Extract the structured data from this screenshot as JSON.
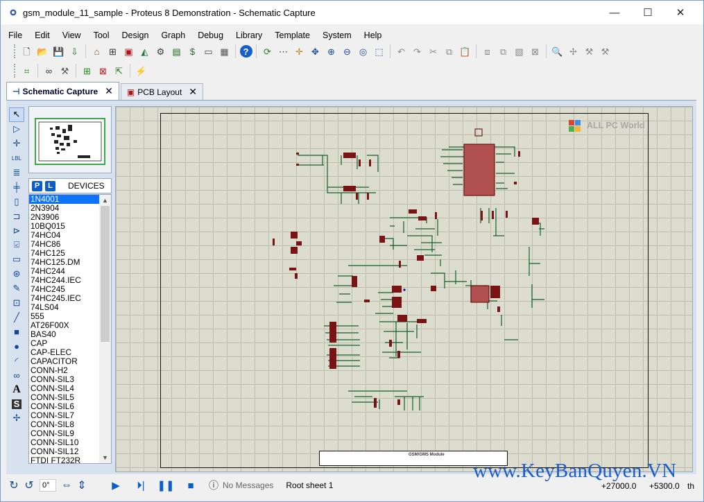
{
  "window": {
    "title": "gsm_module_11_sample - Proteus 8 Demonstration - Schematic Capture",
    "minimize": "—",
    "maximize": "☐",
    "close": "✕"
  },
  "menu": [
    "File",
    "Edit",
    "View",
    "Tool",
    "Design",
    "Graph",
    "Debug",
    "Library",
    "Template",
    "System",
    "Help"
  ],
  "toolbar1": {
    "file_group": [
      {
        "icon": "new-file-icon",
        "glyph": "🗋",
        "color": "#444"
      },
      {
        "icon": "open-folder-icon",
        "glyph": "📂",
        "color": "#c9931c"
      },
      {
        "icon": "save-icon",
        "glyph": "💾",
        "color": "#2a55a0"
      },
      {
        "icon": "import-icon",
        "glyph": "⇩",
        "color": "#2a7a2a"
      }
    ],
    "module_group": [
      {
        "icon": "home-icon",
        "glyph": "⌂",
        "color": "#8a4b12"
      },
      {
        "icon": "schematic-icon",
        "glyph": "⊞",
        "color": "#333"
      },
      {
        "icon": "pcb-icon",
        "glyph": "▣",
        "color": "#b01515"
      },
      {
        "icon": "3d-viewer-icon",
        "glyph": "◭",
        "color": "#1c7a3a"
      },
      {
        "icon": "gerber-icon",
        "glyph": "⚙",
        "color": "#3a3a3a"
      },
      {
        "icon": "design-explorer-icon",
        "glyph": "▤",
        "color": "#1a6a1a"
      },
      {
        "icon": "bom-icon",
        "glyph": "$",
        "color": "#2a6a2a"
      },
      {
        "icon": "source-code-icon",
        "glyph": "▭",
        "color": "#444"
      },
      {
        "icon": "notes-icon",
        "glyph": "▦",
        "color": "#555"
      }
    ],
    "help": {
      "icon": "help-icon",
      "glyph": "?",
      "color": "#fff"
    },
    "view_group": [
      {
        "icon": "refresh-icon",
        "glyph": "⟳",
        "color": "#2a7a2a"
      },
      {
        "icon": "grid-icon",
        "glyph": "⋯",
        "color": "#334"
      },
      {
        "icon": "origin-icon",
        "glyph": "✛",
        "color": "#b8860b"
      },
      {
        "icon": "pan-icon",
        "glyph": "✥",
        "color": "#1a4a9a"
      },
      {
        "icon": "zoom-in-icon",
        "glyph": "⊕",
        "color": "#1a4a9a"
      },
      {
        "icon": "zoom-out-icon",
        "glyph": "⊖",
        "color": "#1a4a9a"
      },
      {
        "icon": "zoom-all-icon",
        "glyph": "◎",
        "color": "#1a4a9a"
      },
      {
        "icon": "zoom-area-icon",
        "glyph": "⬚",
        "color": "#1a4a9a"
      }
    ],
    "edit_group": [
      {
        "icon": "undo-icon",
        "glyph": "↶",
        "color": "#888"
      },
      {
        "icon": "redo-icon",
        "glyph": "↷",
        "color": "#888"
      },
      {
        "icon": "cut-icon",
        "glyph": "✂",
        "color": "#888"
      },
      {
        "icon": "copy-icon",
        "glyph": "⧉",
        "color": "#888"
      },
      {
        "icon": "paste-icon",
        "glyph": "📋",
        "color": "#888"
      }
    ],
    "block_group": [
      {
        "icon": "block-copy-icon",
        "glyph": "⧈",
        "color": "#888"
      },
      {
        "icon": "block-move-icon",
        "glyph": "⧉",
        "color": "#888"
      },
      {
        "icon": "block-rotate-icon",
        "glyph": "▧",
        "color": "#888"
      },
      {
        "icon": "block-delete-icon",
        "glyph": "⊠",
        "color": "#888"
      }
    ],
    "library_group": [
      {
        "icon": "pick-device-icon",
        "glyph": "🔍",
        "color": "#888"
      },
      {
        "icon": "make-device-icon",
        "glyph": "✢",
        "color": "#888"
      },
      {
        "icon": "packaging-tool-icon",
        "glyph": "⚒",
        "color": "#888"
      },
      {
        "icon": "decompose-icon",
        "glyph": "⚒",
        "color": "#888"
      }
    ]
  },
  "toolbar2": [
    {
      "icon": "design-explorer-icon",
      "glyph": "⌗",
      "color": "#1a7a1a"
    },
    {
      "icon": "binoculars-icon",
      "glyph": "∞",
      "color": "#333"
    },
    {
      "icon": "property-tool-icon",
      "glyph": "⚒",
      "color": "#555"
    },
    {
      "icon": "new-sheet-icon",
      "glyph": "⊞",
      "color": "#1a8a1a"
    },
    {
      "icon": "remove-sheet-icon",
      "glyph": "⊠",
      "color": "#c01515"
    },
    {
      "icon": "exit-to-parent-icon",
      "glyph": "⇱",
      "color": "#1a7a1a"
    },
    {
      "icon": "electrical-rules-icon",
      "glyph": "⚡",
      "color": "#1a7a1a"
    }
  ],
  "tabs": [
    {
      "label": "Schematic Capture",
      "icon": "schematic-tab-icon",
      "glyph": "⊣",
      "active": true
    },
    {
      "label": "PCB Layout",
      "icon": "pcb-tab-icon",
      "glyph": "▣",
      "active": false
    }
  ],
  "tab_close": "✕",
  "left_tools": [
    {
      "icon": "selection-mode-icon",
      "glyph": "↖"
    },
    {
      "icon": "component-mode-icon",
      "glyph": "▷"
    },
    {
      "icon": "junction-dot-icon",
      "glyph": "✛"
    },
    {
      "icon": "wire-label-icon",
      "glyph": "LBL"
    },
    {
      "icon": "text-script-icon",
      "glyph": "≣"
    },
    {
      "icon": "buses-icon",
      "glyph": "╪"
    },
    {
      "icon": "subcircuit-icon",
      "glyph": "▯"
    },
    {
      "icon": "terminals-icon",
      "glyph": "⊐"
    },
    {
      "icon": "device-pins-icon",
      "glyph": "⊳"
    },
    {
      "icon": "graph-mode-icon",
      "glyph": "⍃"
    },
    {
      "icon": "tape-recorder-icon",
      "glyph": "▭"
    },
    {
      "icon": "generator-icon",
      "glyph": "⊛"
    },
    {
      "icon": "voltage-probe-icon",
      "glyph": "✎"
    },
    {
      "icon": "virtual-instruments-icon",
      "glyph": "⊡"
    },
    {
      "icon": "line-icon",
      "glyph": "╱"
    },
    {
      "icon": "box-icon",
      "glyph": "■"
    },
    {
      "icon": "circle-icon",
      "glyph": "●"
    },
    {
      "icon": "arc-icon",
      "glyph": "◜"
    },
    {
      "icon": "path-icon",
      "glyph": "∞"
    },
    {
      "icon": "text-icon",
      "glyph": "A"
    },
    {
      "icon": "symbol-icon",
      "glyph": "S"
    },
    {
      "icon": "marker-icon",
      "glyph": "✢"
    }
  ],
  "devices": {
    "p_button": "P",
    "l_button": "L",
    "label": "DEVICES",
    "items": [
      "1N4001",
      "2N3904",
      "2N3906",
      "10BQ015",
      "74HC04",
      "74HC86",
      "74HC125",
      "74HC125.DM",
      "74HC244",
      "74HC244.IEC",
      "74HC245",
      "74HC245.IEC",
      "74LS04",
      "555",
      "AT26F00X",
      "BAS40",
      "CAP",
      "CAP-ELEC",
      "CAPACITOR",
      "CONN-H2",
      "CONN-SIL3",
      "CONN-SIL4",
      "CONN-SIL5",
      "CONN-SIL6",
      "CONN-SIL7",
      "CONN-SIL8",
      "CONN-SIL9",
      "CONN-SIL10",
      "CONN-SIL12",
      "FTDI FT232R"
    ],
    "selected": "1N4001"
  },
  "title_block": {
    "text": "GSM/GMS Module"
  },
  "watermark_top": "ALL PC World",
  "watermark_bottom": "www.KeyBanQuyen.VN",
  "status": {
    "angle": "0°",
    "messages": "No Messages",
    "sheet": "Root sheet 1",
    "x_coord": "+27000.0",
    "y_coord": "+5300.0",
    "units": "th"
  }
}
